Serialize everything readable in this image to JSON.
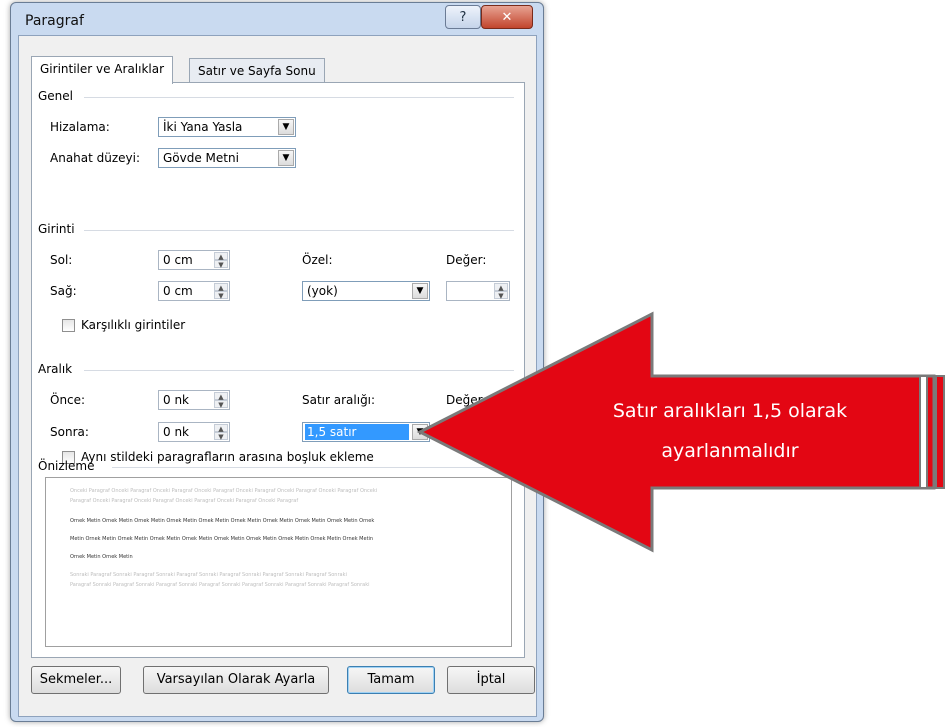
{
  "window": {
    "title": "Paragraf",
    "help_label": "?",
    "close_label": "✕"
  },
  "tabs": [
    {
      "label": "Girintiler ve Aralıklar",
      "active": true
    },
    {
      "label": "Satır ve Sayfa Sonu",
      "active": false
    }
  ],
  "genel": {
    "heading": "Genel",
    "alignment_label": "Hizalama:",
    "alignment_value": "İki Yana Yasla",
    "outline_label": "Anahat düzeyi:",
    "outline_value": "Gövde Metni"
  },
  "girinti": {
    "heading": "Girinti",
    "left_label": "Sol:",
    "left_value": "0 cm",
    "right_label": "Sağ:",
    "right_value": "0 cm",
    "special_label": "Özel:",
    "special_value": "(yok)",
    "by_label": "Değer:",
    "by_value": "",
    "mirror_label": "Karşılıklı girintiler"
  },
  "aralik": {
    "heading": "Aralık",
    "before_label": "Önce:",
    "before_value": "0 nk",
    "after_label": "Sonra:",
    "after_value": "0 nk",
    "line_spacing_label": "Satır aralığı:",
    "line_spacing_value": "1,5 satır",
    "at_label": "Değer:",
    "no_space_label": "Aynı stildeki paragrafların arasına boşluk ekleme"
  },
  "onizleme": {
    "heading": "Önizleme",
    "lines": [
      "Önceki Paragraf Önceki Paragraf Önceki Paragraf Önceki Paragraf Önceki Paragraf Önceki Paragraf Önceki Paragraf Önceki",
      "Paragraf Önceki Paragraf Önceki Paragraf Önceki Paragraf Önceki Paragraf Önceki Paragraf",
      "Örnek Metin Örnek Metin Örnek Metin Örnek Metin Örnek Metin Örnek Metin Örnek Metin Örnek Metin Örnek Metin Örnek",
      "Metin Örnek Metin Örnek Metin Örnek Metin Örnek Metin Örnek Metin Örnek Metin Örnek Metin Örnek Metin Örnek Metin",
      "Örnek Metin Örnek Metin",
      "Sonraki Paragraf Sonraki Paragraf Sonraki Paragraf Sonraki Paragraf Sonraki Paragraf Sonraki Paragraf Sonraki",
      "Paragraf Sonraki Paragraf Sonraki Paragraf Sonraki Paragraf Sonraki Paragraf Sonraki Paragraf Sonraki Paragraf Sonraki"
    ]
  },
  "buttons": {
    "tabs": "Sekmeler...",
    "default": "Varsayılan Olarak Ayarla",
    "ok": "Tamam",
    "cancel": "İptal"
  },
  "callout": {
    "line1": "Satır aralıkları 1,5 olarak",
    "line2": "ayarlanmalıdır",
    "color": "#e30613"
  }
}
